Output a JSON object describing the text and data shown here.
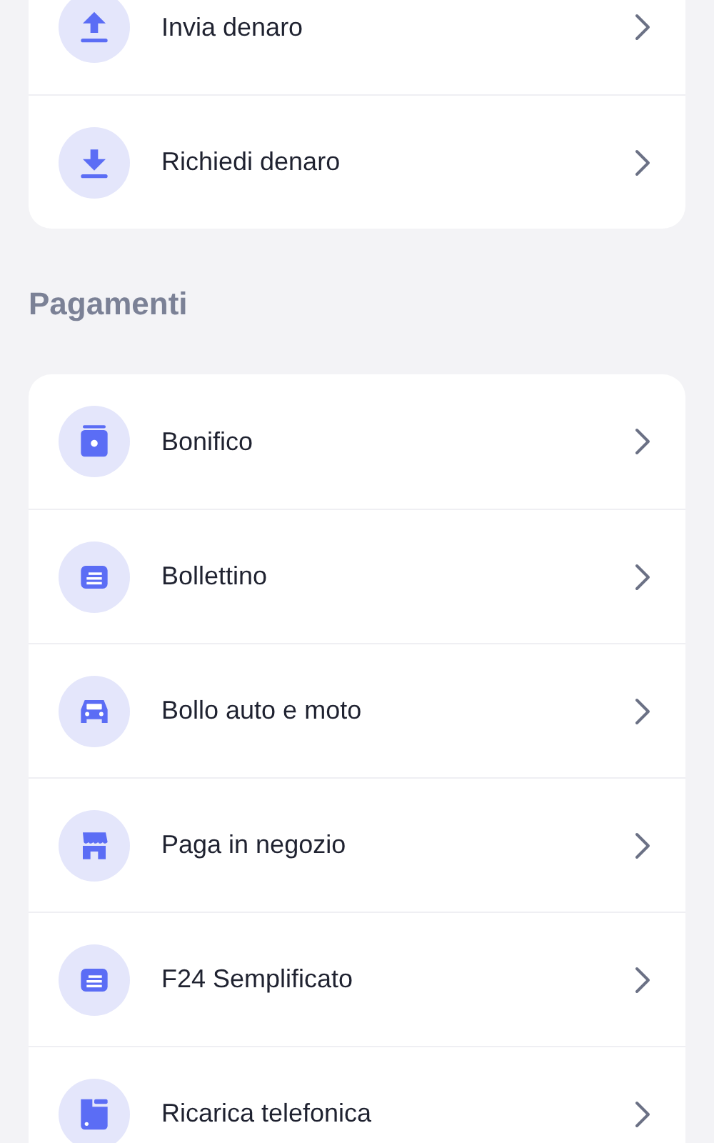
{
  "sections": [
    {
      "items": [
        {
          "label": "Invia denaro",
          "kind": "upload"
        },
        {
          "label": "Richiedi denaro",
          "kind": "download"
        }
      ]
    },
    {
      "title": "Pagamenti",
      "items": [
        {
          "label": "Bonifico",
          "kind": "safe"
        },
        {
          "label": "Bollettino",
          "kind": "document"
        },
        {
          "label": "Bollo auto e moto",
          "kind": "car"
        },
        {
          "label": "Paga in negozio",
          "kind": "store"
        },
        {
          "label": "F24 Semplificato",
          "kind": "document"
        },
        {
          "label": "Ricarica telefonica",
          "kind": "sim"
        }
      ]
    }
  ]
}
